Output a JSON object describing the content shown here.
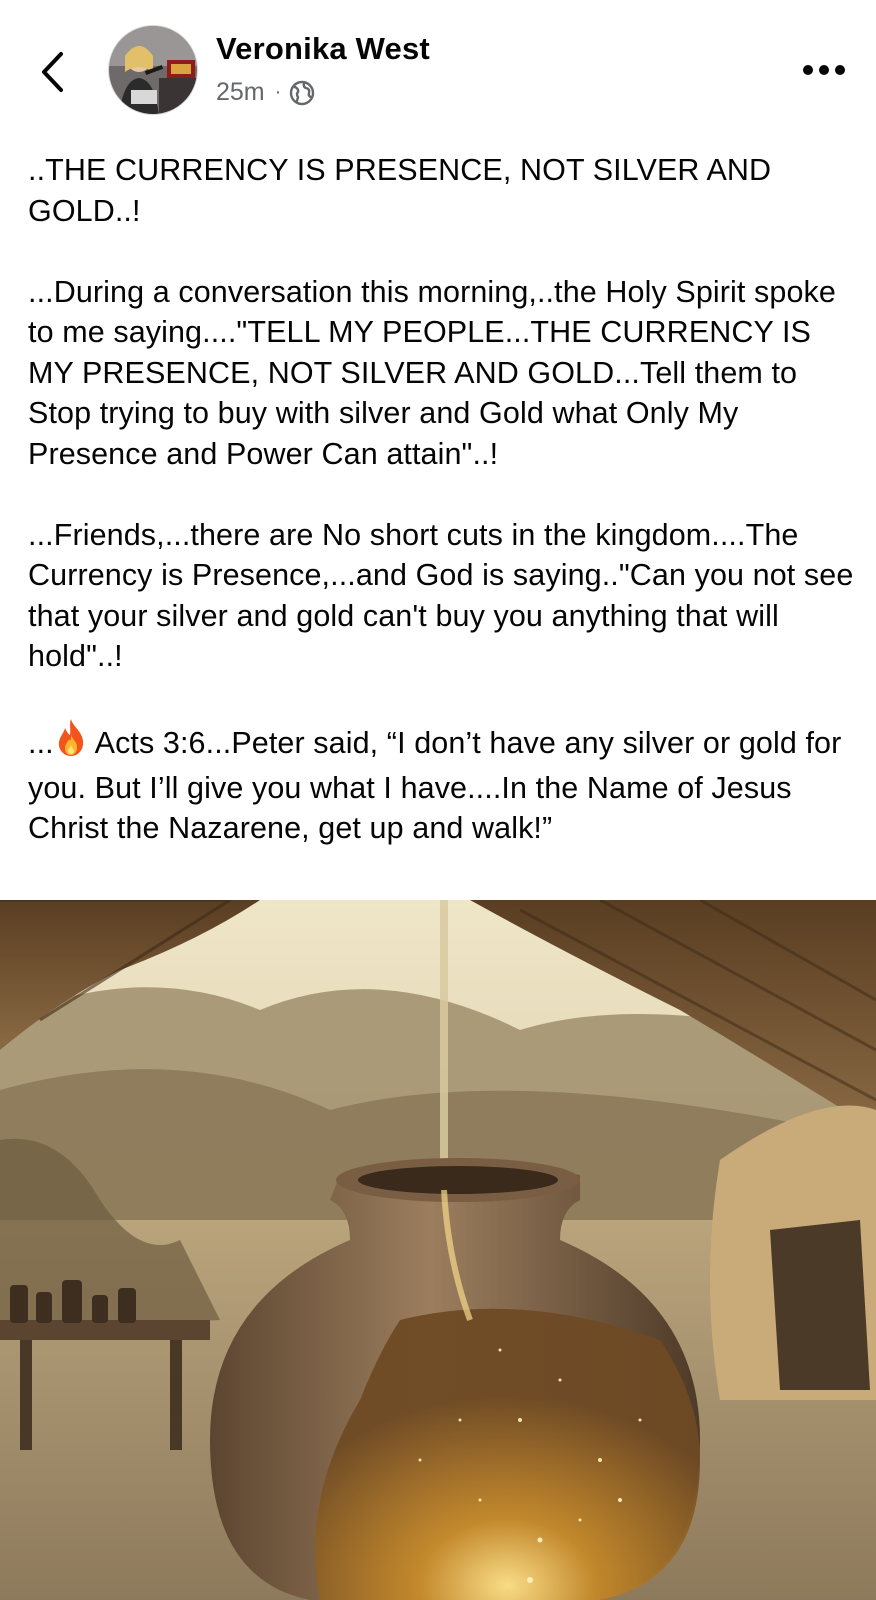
{
  "header": {
    "back_icon": "chevron-left-icon",
    "author_name": "Veronika West",
    "timestamp": "25m",
    "separator": "·",
    "privacy_icon": "globe-icon",
    "more_icon": "ellipsis-icon"
  },
  "post": {
    "paragraphs": [
      "..THE CURRENCY IS PRESENCE, NOT SILVER AND GOLD..!",
      "...During a conversation this morning,..the Holy Spirit spoke to me saying....\"TELL MY PEOPLE...THE CURRENCY IS MY PRESENCE, NOT SILVER AND GOLD...Tell them to Stop trying to buy with silver and Gold what Only My Presence and Power Can attain\"..!",
      "...Friends,...there are No short cuts in the kingdom....The Currency is Presence,...and God is saying..\"Can you not see that your silver and gold can't buy you anything that will hold\"..!"
    ],
    "last_paragraph_prefix": "...",
    "last_paragraph_emoji_icon": "fire-icon",
    "last_paragraph_text": " Acts 3:6...Peter said, “I don’t have any silver or gold for you. But I’ll give you what I have....In the Name of Jesus Christ the Nazarene, get up and walk!”",
    "image_icon": "clay-jar-honey-image"
  },
  "colors": {
    "text": "#050505",
    "secondary_text": "#65676b",
    "background": "#ffffff"
  }
}
